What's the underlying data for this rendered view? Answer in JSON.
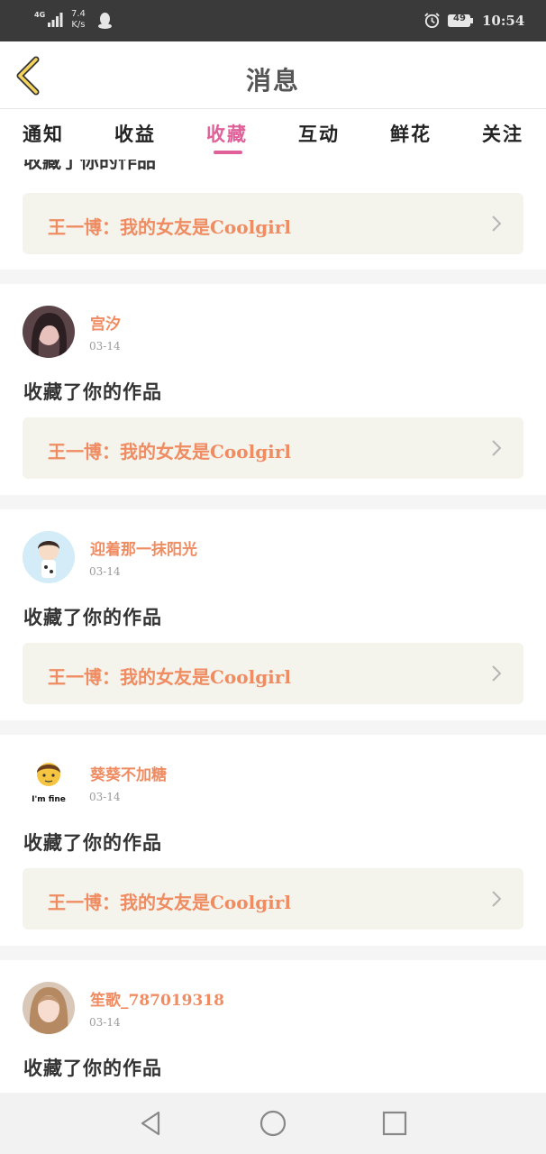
{
  "status_bar": {
    "network": "4G",
    "speed_value": "7.4",
    "speed_unit": "K/s",
    "battery": "49",
    "time": "10:54"
  },
  "header": {
    "title": "消息"
  },
  "tabs": [
    {
      "label": "通知"
    },
    {
      "label": "收益"
    },
    {
      "label": "收藏",
      "active": true
    },
    {
      "label": "互动"
    },
    {
      "label": "鲜花"
    },
    {
      "label": "关注"
    }
  ],
  "partial_entry": {
    "action": "收藏了你的作品",
    "work_title": "王一博：我的女友是Coolgirl"
  },
  "entries": [
    {
      "user": "宫汐",
      "date": "03-14",
      "action": "收藏了你的作品",
      "work_title": "王一博：我的女友是Coolgirl"
    },
    {
      "user": "迎着那一抹阳光",
      "date": "03-14",
      "action": "收藏了你的作品",
      "work_title": "王一博：我的女友是Coolgirl"
    },
    {
      "user": "葵葵不加糖",
      "date": "03-14",
      "action": "收藏了你的作品",
      "work_title": "王一博：我的女友是Coolgirl",
      "avatar_caption": "I'm fine"
    },
    {
      "user": "笙歌_787019318",
      "date": "03-14",
      "action": "收藏了你的作品"
    }
  ],
  "colors": {
    "accent_pink": "#e0609a",
    "username_orange": "#ef8c62",
    "card_bg": "#f4f3ec"
  },
  "icons": [
    "back-arrow-icon",
    "signal-icon",
    "qq-icon",
    "alarm-icon",
    "battery-icon",
    "chevron-right-icon",
    "nav-back-icon",
    "nav-home-icon",
    "nav-recents-icon"
  ]
}
